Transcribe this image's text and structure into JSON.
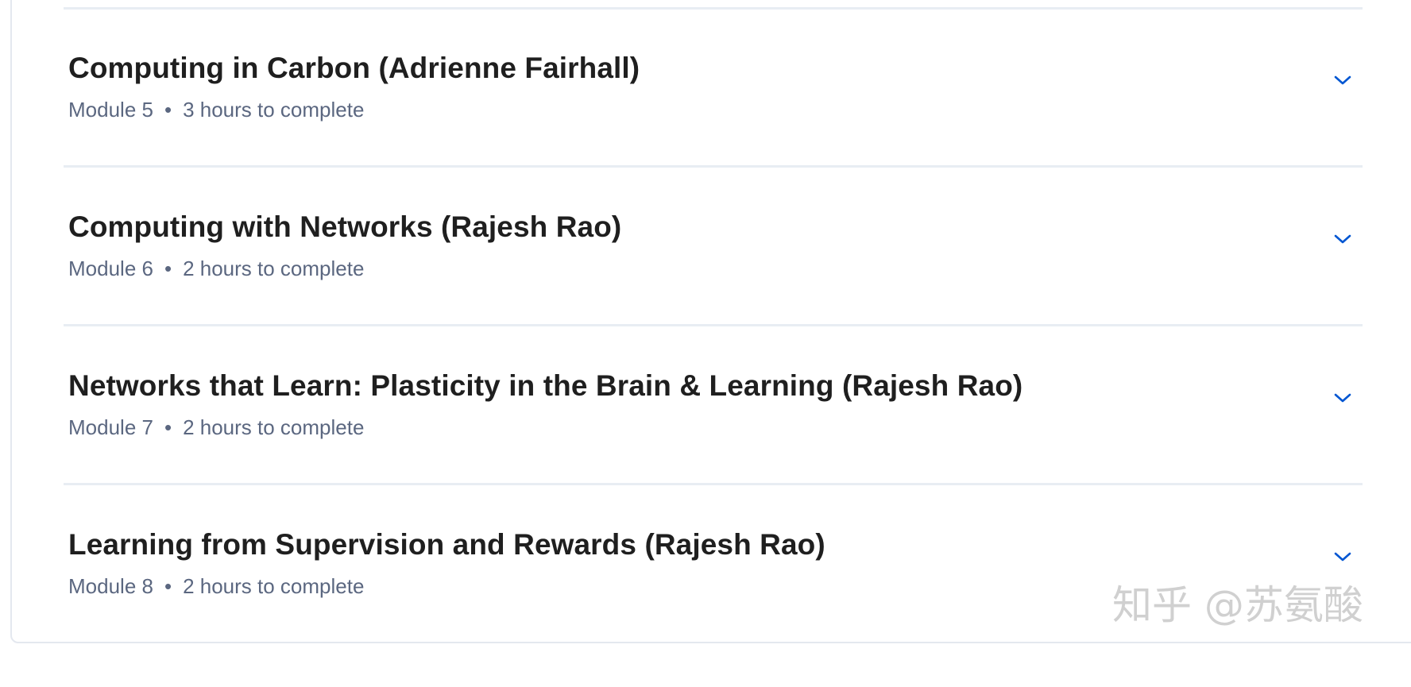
{
  "modules": [
    {
      "title": "Computing in Carbon (Adrienne Fairhall)",
      "module_label": "Module 5",
      "duration": "3 hours to complete"
    },
    {
      "title": "Computing with Networks (Rajesh Rao)",
      "module_label": "Module 6",
      "duration": "2 hours to complete"
    },
    {
      "title": "Networks that Learn: Plasticity in the Brain & Learning (Rajesh Rao)",
      "module_label": "Module 7",
      "duration": "2 hours to complete"
    },
    {
      "title": "Learning from Supervision and Rewards (Rajesh Rao)",
      "module_label": "Module 8",
      "duration": "2 hours to complete"
    }
  ],
  "separator": "•",
  "icons": {
    "expand": "chevron-down-icon"
  },
  "colors": {
    "title": "#1f1f1f",
    "meta": "#5b6780",
    "accent": "#0056d2",
    "divider": "#e8edf3"
  },
  "watermark": "知乎 @苏氨酸"
}
